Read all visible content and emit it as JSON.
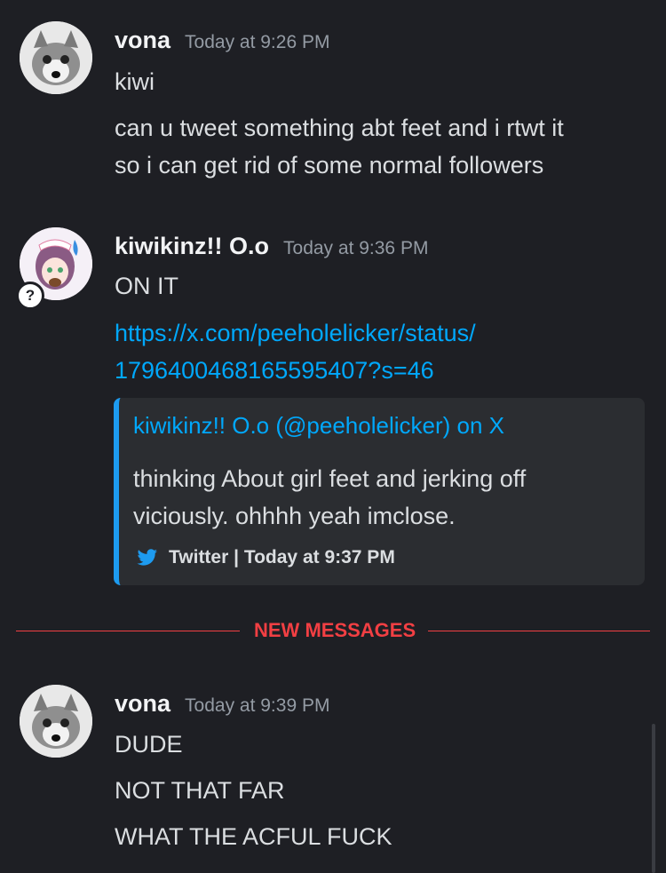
{
  "messages": [
    {
      "username": "vona",
      "timestamp": "Today at 9:26 PM",
      "lines": [
        "kiwi",
        "can u tweet something abt feet and i rtwt it",
        "so i can get rid of some normal followers"
      ]
    },
    {
      "username": "kiwikinz!! O.o",
      "timestamp": "Today at 9:36 PM",
      "lines": [
        "ON IT"
      ],
      "link_lines": [
        "https://x.com/peeholelicker/status/",
        "1796400468165595407?s=46"
      ],
      "embed": {
        "title": "kiwikinz!! O.o (@peeholelicker) on X",
        "description_lines": [
          "thinking About girl feet and jerking off",
          "viciously. ohhhh yeah imclose."
        ],
        "footer": "Twitter | Today at 9:37 PM",
        "icon": "twitter-bird-icon"
      },
      "status_badge": "?"
    },
    {
      "username": "vona",
      "timestamp": "Today at 9:39 PM",
      "lines": [
        "DUDE",
        "NOT THAT FAR",
        "WHAT THE ACFUL FUCK"
      ]
    }
  ],
  "divider": {
    "label": "NEW MESSAGES"
  },
  "colors": {
    "background": "#1e1f24",
    "link": "#00a8fc",
    "divider": "#f23f43",
    "embed_bar": "#1d9bf0",
    "embed_bg": "#2b2d31"
  }
}
